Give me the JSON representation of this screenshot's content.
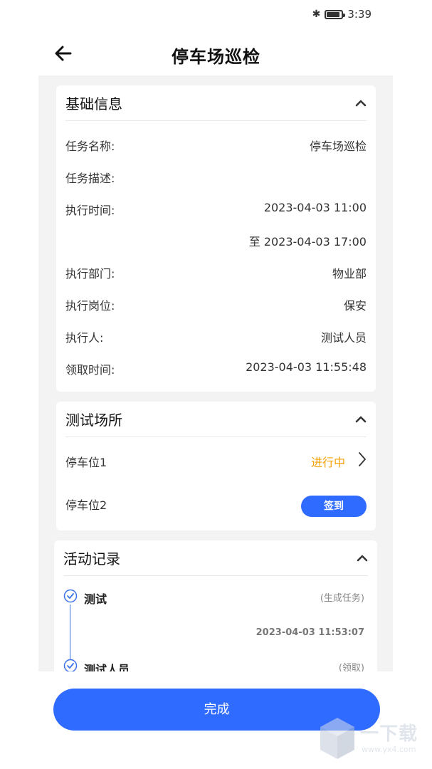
{
  "status_bar": {
    "time": "3:39",
    "bluetooth_icon": "bluetooth-icon",
    "battery_icon": "battery-icon"
  },
  "header": {
    "title": "停车场巡检",
    "back_icon": "back-arrow-icon"
  },
  "basic_info": {
    "title": "基础信息",
    "rows": [
      {
        "label": "任务名称:",
        "value": "停车场巡检"
      },
      {
        "label": "任务描述:",
        "value": ""
      },
      {
        "label": "执行时间:",
        "value": "2023-04-03 11:00"
      },
      {
        "label": "",
        "value": "至 2023-04-03 17:00"
      },
      {
        "label": "执行部门:",
        "value": "物业部"
      },
      {
        "label": "执行岗位:",
        "value": "保安"
      },
      {
        "label": "执行人:",
        "value": "测试人员"
      },
      {
        "label": "领取时间:",
        "value": "2023-04-03 11:55:48"
      }
    ]
  },
  "places": {
    "title": "测试场所",
    "items": [
      {
        "name": "停车位1",
        "status": "进行中"
      },
      {
        "name": "停车位2",
        "action": "签到"
      }
    ]
  },
  "activity": {
    "title": "活动记录",
    "entries": [
      {
        "title": "测试",
        "tag": "(生成任务)",
        "time": "2023-04-03 11:53:07"
      },
      {
        "title": "测试人员",
        "tag": "(领取)"
      }
    ]
  },
  "finish_button": "完成",
  "watermark": {
    "text": "一下载",
    "url": "www.yx4.com"
  },
  "colors": {
    "accent": "#2f6bff",
    "ongoing": "#f5a20a",
    "timeline": "#3a72e8"
  }
}
